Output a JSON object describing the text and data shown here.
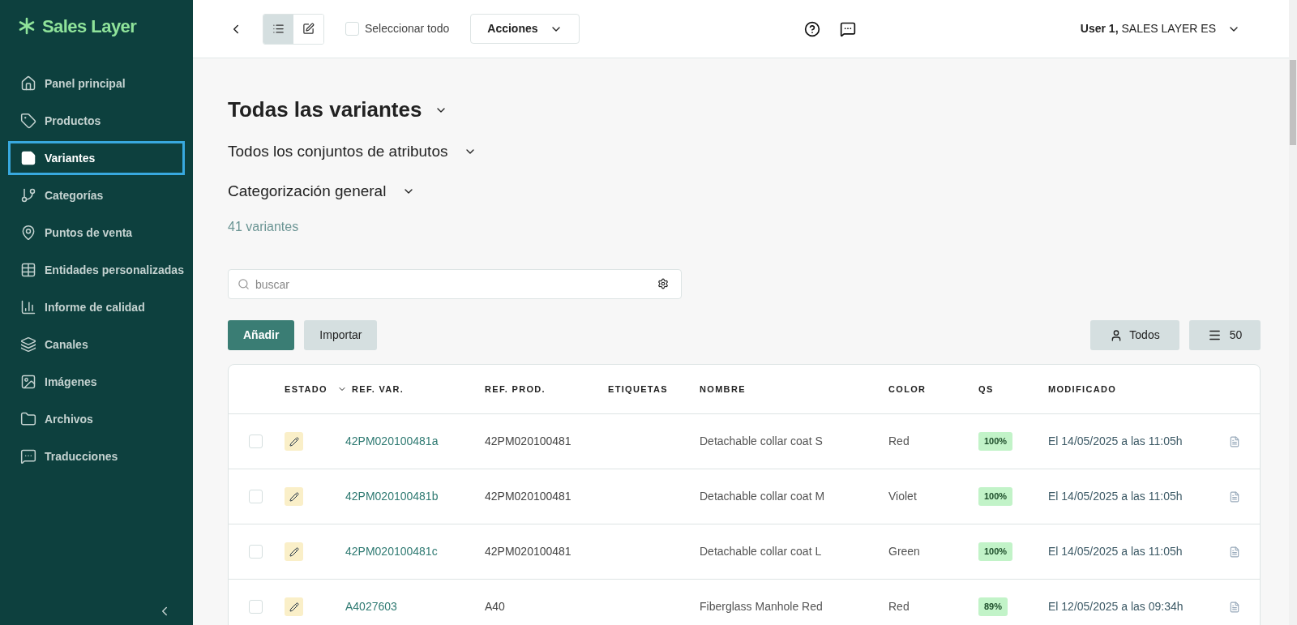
{
  "brand": {
    "name": "Sales Layer"
  },
  "sidebar": {
    "items": [
      {
        "label": "Panel principal",
        "selected": false
      },
      {
        "label": "Productos",
        "selected": false
      },
      {
        "label": "Variantes",
        "selected": true
      },
      {
        "label": "Categorías",
        "selected": false
      },
      {
        "label": "Puntos de venta",
        "selected": false
      },
      {
        "label": "Entidades personalizadas",
        "selected": false
      },
      {
        "label": "Informe de calidad",
        "selected": false
      },
      {
        "label": "Canales",
        "selected": false
      },
      {
        "label": "Imágenes",
        "selected": false
      },
      {
        "label": "Archivos",
        "selected": false
      },
      {
        "label": "Traducciones",
        "selected": false
      }
    ]
  },
  "toolbar": {
    "views": [
      {
        "selected": true
      },
      {
        "selected": false
      }
    ],
    "select_all": {
      "label": "Seleccionar todo",
      "checked": false
    },
    "actions": "Acciones",
    "user": {
      "name": "User 1,",
      "company": "SALES LAYER ES"
    }
  },
  "page": {
    "title": "Todas las variantes",
    "attribute_set": "Todos los conjuntos de atributos",
    "categorization": "Categorización general",
    "count": "41 variantes"
  },
  "search": {
    "placeholder": "buscar"
  },
  "buttons": {
    "add": "Añadir",
    "import": "Importar",
    "filter": "Todos",
    "per_page": "50"
  },
  "table": {
    "columns": [
      {
        "label": "ESTADO",
        "sorted": false
      },
      {
        "label": "REF. VAR.",
        "sorted": true
      },
      {
        "label": "REF. PROD.",
        "sorted": false
      },
      {
        "label": "ETIQUETAS",
        "sorted": false
      },
      {
        "label": "NOMBRE",
        "sorted": false
      },
      {
        "label": "COLOR",
        "sorted": false
      },
      {
        "label": "QS",
        "sorted": false
      },
      {
        "label": "MODIFICADO",
        "sorted": false
      }
    ],
    "rows": [
      {
        "checked": false,
        "ref_var": "42PM020100481a",
        "ref_prod": "42PM020100481",
        "name": "Detachable collar coat S",
        "color_name": "Red",
        "qs": "100%",
        "modified": "El 14/05/2025 a las 11:05h"
      },
      {
        "checked": false,
        "ref_var": "42PM020100481b",
        "ref_prod": "42PM020100481",
        "name": "Detachable collar coat M",
        "color_name": "Violet",
        "qs": "100%",
        "modified": "El 14/05/2025 a las 11:05h"
      },
      {
        "checked": false,
        "ref_var": "42PM020100481c",
        "ref_prod": "42PM020100481",
        "name": "Detachable collar coat L",
        "color_name": "Green",
        "qs": "100%",
        "modified": "El 14/05/2025 a las 11:05h"
      },
      {
        "checked": false,
        "ref_var": "A4027603",
        "ref_prod": "A40",
        "name": "Fiberglass Manhole Red",
        "color_name": "Red",
        "qs": "89%",
        "modified": "El 12/05/2025 a las 09:34h"
      }
    ]
  }
}
